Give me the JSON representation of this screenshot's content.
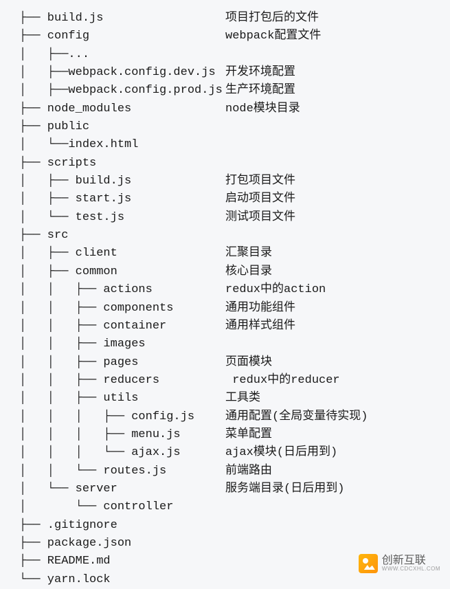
{
  "rows": [
    {
      "tree": "├── build.js",
      "desc": "项目打包后的文件"
    },
    {
      "tree": "├── config",
      "desc": "webpack配置文件"
    },
    {
      "tree": "│   ├──...",
      "desc": ""
    },
    {
      "tree": "│   ├──webpack.config.dev.js",
      "desc": "开发环境配置"
    },
    {
      "tree": "│   ├──webpack.config.prod.js",
      "desc": "生产环境配置"
    },
    {
      "tree": "├── node_modules",
      "desc": "node模块目录"
    },
    {
      "tree": "├── public",
      "desc": ""
    },
    {
      "tree": "│   └──index.html",
      "desc": ""
    },
    {
      "tree": "├── scripts",
      "desc": ""
    },
    {
      "tree": "│   ├── build.js",
      "desc": "打包项目文件"
    },
    {
      "tree": "│   ├── start.js",
      "desc": "启动项目文件"
    },
    {
      "tree": "│   └── test.js",
      "desc": "测试项目文件"
    },
    {
      "tree": "├── src",
      "desc": ""
    },
    {
      "tree": "│   ├── client",
      "desc": "汇聚目录"
    },
    {
      "tree": "│   ├── common",
      "desc": "核心目录"
    },
    {
      "tree": "│   │   ├── actions",
      "desc": "redux中的action"
    },
    {
      "tree": "│   │   ├── components",
      "desc": "通用功能组件"
    },
    {
      "tree": "│   │   ├── container",
      "desc": "通用样式组件"
    },
    {
      "tree": "│   │   ├── images",
      "desc": ""
    },
    {
      "tree": "│   │   ├── pages",
      "desc": "页面模块"
    },
    {
      "tree": "│   │   ├── reducers",
      "desc": " redux中的reducer"
    },
    {
      "tree": "│   │   ├── utils",
      "desc": "工具类"
    },
    {
      "tree": "│   │   │   ├── config.js",
      "desc": "通用配置(全局变量待实现)"
    },
    {
      "tree": "│   │   │   ├── menu.js",
      "desc": "菜单配置"
    },
    {
      "tree": "│   │   │   └── ajax.js",
      "desc": "ajax模块(日后用到)"
    },
    {
      "tree": "│   │   └── routes.js",
      "desc": "前端路由"
    },
    {
      "tree": "│   └── server",
      "desc": "服务端目录(日后用到)"
    },
    {
      "tree": "│       └── controller",
      "desc": ""
    },
    {
      "tree": "├── .gitignore",
      "desc": ""
    },
    {
      "tree": "├── package.json",
      "desc": ""
    },
    {
      "tree": "├── README.md",
      "desc": ""
    },
    {
      "tree": "└── yarn.lock",
      "desc": ""
    }
  ],
  "watermark": {
    "main": "创新互联",
    "sub": "WWW.CDCXHL.COM"
  }
}
